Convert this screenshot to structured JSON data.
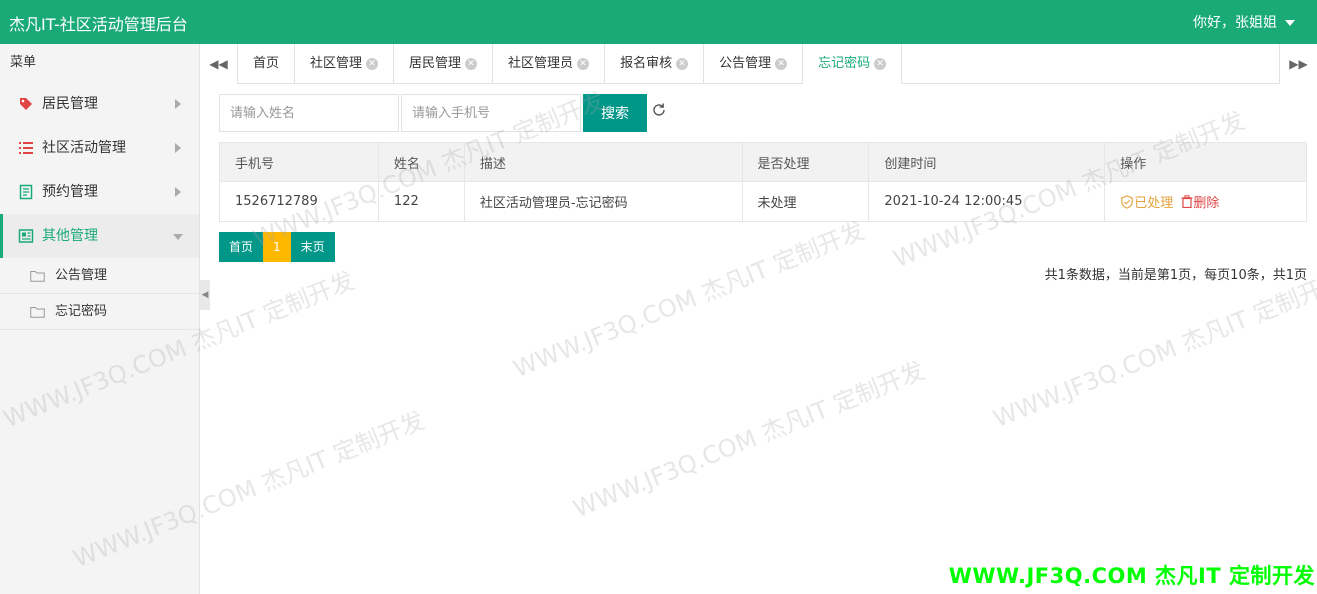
{
  "app": {
    "title": "杰凡IT-社区活动管理后台",
    "greeting": "你好，张姐姐",
    "accent": "#1aaa78",
    "button_color": "#009688",
    "highlight_color": "#ffb800"
  },
  "sidebar": {
    "header": "菜单",
    "items": [
      {
        "label": "居民管理",
        "icon": "tag-icon"
      },
      {
        "label": "社区活动管理",
        "icon": "list-icon"
      },
      {
        "label": "预约管理",
        "icon": "document-icon"
      },
      {
        "label": "其他管理",
        "icon": "newspaper-icon",
        "expanded": true
      }
    ],
    "subitems": [
      {
        "label": "公告管理",
        "icon": "folder-icon"
      },
      {
        "label": "忘记密码",
        "icon": "folder-icon"
      }
    ]
  },
  "tabs": [
    {
      "label": "首页",
      "closable": false
    },
    {
      "label": "社区管理",
      "closable": true
    },
    {
      "label": "居民管理",
      "closable": true
    },
    {
      "label": "社区管理员",
      "closable": true
    },
    {
      "label": "报名审核",
      "closable": true
    },
    {
      "label": "公告管理",
      "closable": true
    },
    {
      "label": "忘记密码",
      "closable": true,
      "active": true
    }
  ],
  "search": {
    "name_placeholder": "请输入姓名",
    "phone_placeholder": "请输入手机号",
    "button": "搜索"
  },
  "table": {
    "columns": [
      "手机号",
      "姓名",
      "描述",
      "是否处理",
      "创建时间",
      "操作"
    ],
    "rows": [
      {
        "phone": "1526712789",
        "name": "122",
        "desc": "社区活动管理员-忘记密码",
        "status": "未处理",
        "created": "2021-10-24 12:00:45",
        "action_done": "已处理",
        "action_delete": "删除"
      }
    ]
  },
  "pager": {
    "first": "首页",
    "current": "1",
    "last": "末页",
    "info": "共1条数据，当前是第1页，每页10条，共1页"
  },
  "watermark": {
    "text": "WWW.JF3Q.COM 杰凡IT  定制开发"
  }
}
